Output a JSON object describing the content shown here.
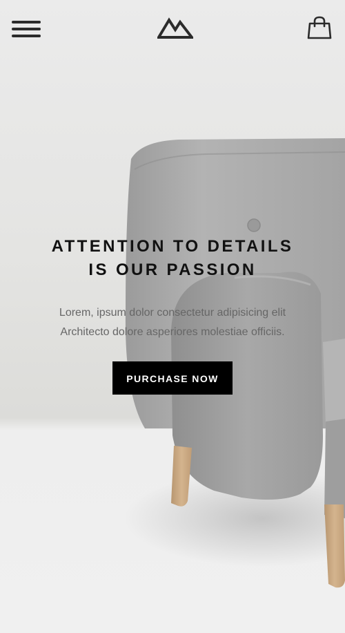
{
  "header": {
    "menu_icon": "hamburger-menu-icon",
    "logo_icon": "mountain-logo-icon",
    "cart_icon": "shopping-bag-icon"
  },
  "hero": {
    "title_line1": "ATTENTION TO DETAILS",
    "title_line2": "IS OUR PASSION",
    "text_line1": "Lorem, ipsum dolor consectetur adipisicing elit",
    "text_line2": "Architecto dolore asperiores molestiae officiis.",
    "cta_label": "PURCHASE NOW"
  },
  "colors": {
    "background": "#ebebeb",
    "floor": "#f0f0f0",
    "button": "#000000",
    "button_text": "#ffffff",
    "title": "#111111",
    "body_text": "#666666",
    "chair_fabric": "#a9a9a9",
    "chair_legs": "#c8a882"
  }
}
